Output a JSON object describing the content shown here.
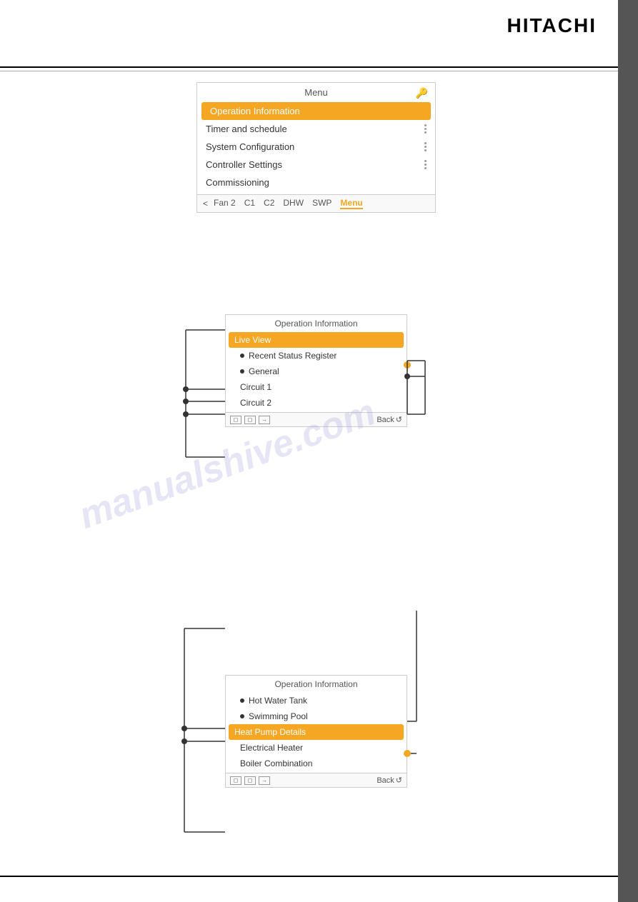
{
  "brand": {
    "name": "HITACHI"
  },
  "menu_panel": {
    "title": "Menu",
    "lock_icon": "🔑",
    "items": [
      {
        "label": "Operation Information",
        "active": true,
        "has_dots": false
      },
      {
        "label": "Timer and schedule",
        "active": false,
        "has_dots": true
      },
      {
        "label": "System Configuration",
        "active": false,
        "has_dots": true
      },
      {
        "label": "Controller Settings",
        "active": false,
        "has_dots": true
      },
      {
        "label": "Commissioning",
        "active": false,
        "has_dots": false
      }
    ],
    "nav": {
      "arrow": "<",
      "items": [
        "Fan 2",
        "C1",
        "C2",
        "DHW",
        "SWP",
        "Menu"
      ],
      "active_item": "Menu"
    }
  },
  "op_panel_mid": {
    "title": "Operation Information",
    "items": [
      {
        "label": "Live View",
        "active": true,
        "has_bullet": false
      },
      {
        "label": "Recent Status Register",
        "active": false,
        "has_bullet": true
      },
      {
        "label": "General",
        "active": false,
        "has_bullet": true
      },
      {
        "label": "Circuit 1",
        "active": false,
        "has_bullet": false
      },
      {
        "label": "Circuit 2",
        "active": false,
        "has_bullet": false
      }
    ],
    "nav": {
      "back_label": "Back"
    }
  },
  "op_panel_bot": {
    "title": "Operation Information",
    "items": [
      {
        "label": "Hot Water Tank",
        "active": false,
        "has_bullet": true
      },
      {
        "label": "Swimming Pool",
        "active": false,
        "has_bullet": true
      },
      {
        "label": "Heat Pump Details",
        "active": true,
        "has_bullet": false
      },
      {
        "label": "Electrical Heater",
        "active": false,
        "has_bullet": false
      },
      {
        "label": "Boiler Combination",
        "active": false,
        "has_bullet": false
      }
    ],
    "nav": {
      "back_label": "Back"
    }
  },
  "watermark": "manualshive.com"
}
